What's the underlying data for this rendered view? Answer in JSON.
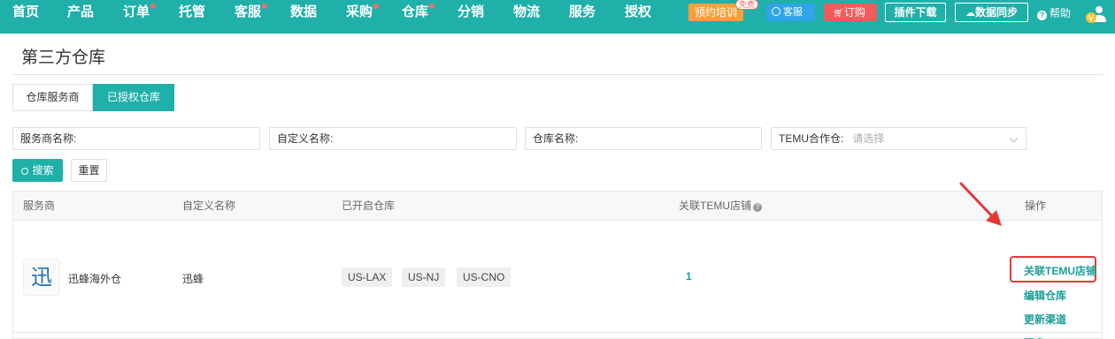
{
  "nav": {
    "items": [
      {
        "label": "首页",
        "dot": false
      },
      {
        "label": "产品",
        "dot": false
      },
      {
        "label": "订单",
        "dot": true
      },
      {
        "label": "托管",
        "dot": false
      },
      {
        "label": "客服",
        "dot": true
      },
      {
        "label": "数据",
        "dot": false
      },
      {
        "label": "采购",
        "dot": true
      },
      {
        "label": "仓库",
        "dot": true
      },
      {
        "label": "分销",
        "dot": false
      },
      {
        "label": "物流",
        "dot": false
      },
      {
        "label": "服务",
        "dot": false
      },
      {
        "label": "授权",
        "dot": false
      }
    ],
    "train_label": "预约培训",
    "free_badge": "免费",
    "service_label": "客服",
    "order_label": "订购",
    "plugin_label": "插件下载",
    "sync_label": "数据同步",
    "help_label": "帮助",
    "avatar_letter": "V"
  },
  "page": {
    "title": "第三方仓库",
    "tabs": [
      "仓库服务商",
      "已授权仓库"
    ],
    "active_tab": 1
  },
  "filters": {
    "provider_label": "服务商名称:",
    "custom_label": "自定义名称:",
    "warehouse_label": "仓库名称:",
    "temu_label": "TEMU合作仓:",
    "temu_placeholder": "请选择"
  },
  "actions": {
    "search_label": "搜索",
    "reset_label": "重置"
  },
  "table": {
    "headers": {
      "provider": "服务商",
      "custom_name": "自定义名称",
      "enabled": "已开启仓库",
      "temu_stores": "关联TEMU店铺",
      "ops": "操作"
    },
    "rows": [
      {
        "logo_char": "迅",
        "provider": "迅蜂海外仓",
        "custom_name": "迅蜂",
        "warehouses": [
          "US-LAX",
          "US-NJ",
          "US-CNO"
        ],
        "temu_count": "1",
        "ops": [
          "关联TEMU店铺",
          "编辑仓库",
          "更新渠道",
          "更多"
        ]
      }
    ]
  },
  "colors": {
    "brand": "#1fb0aa",
    "link": "#1a9f99",
    "alert": "#e53935"
  }
}
